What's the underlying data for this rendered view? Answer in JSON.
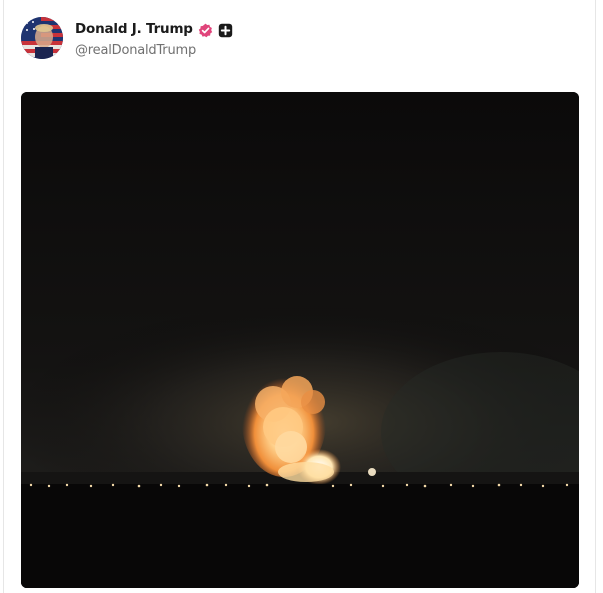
{
  "post": {
    "author": {
      "display_name": "Donald J. Trump",
      "handle": "@realDonaldTrump",
      "avatar_icon": "avatar-flag-portrait",
      "verified_badge_icon": "verified-check-badge",
      "verified_badge_color": "#e0457b",
      "extra_badge_icon": "plus-square-badge"
    },
    "media": {
      "type": "video-still",
      "scene": "night-explosion-fireball"
    }
  }
}
